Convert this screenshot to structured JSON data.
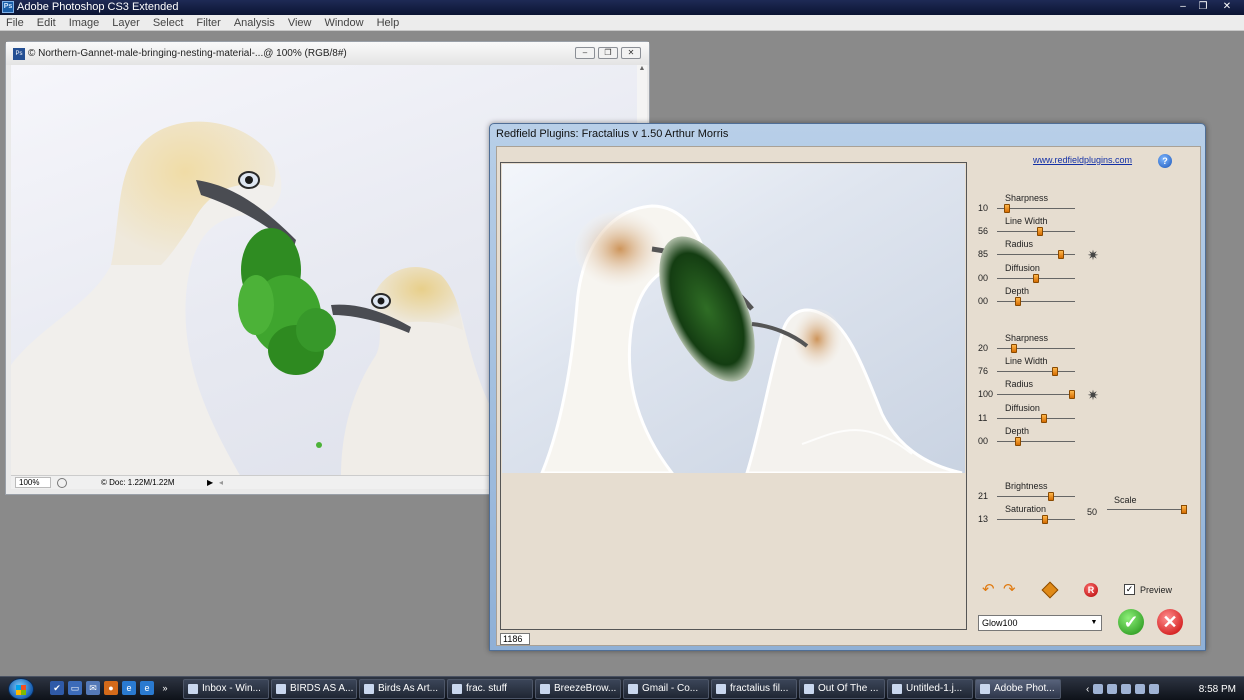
{
  "app": {
    "title": "Adobe Photoshop CS3 Extended",
    "logo": "Ps",
    "controls": {
      "minimize": "–",
      "restore": "❐",
      "close": "✕"
    }
  },
  "menu": [
    "File",
    "Edit",
    "Image",
    "Layer",
    "Select",
    "Filter",
    "Analysis",
    "View",
    "Window",
    "Help"
  ],
  "document": {
    "title": "© Northern-Gannet-male-bringing-nesting-material-...@ 100% (RGB/8#)",
    "icon": "Ps",
    "zoom": "100%",
    "doc_info": "© Doc: 1.22M/1.22M"
  },
  "plugin": {
    "title": "Redfield Plugins: Fractalius v 1.50   Arthur Morris",
    "link": "www.redfieldplugins.com",
    "help_label": "?",
    "counter": "1186",
    "group1": [
      {
        "label": "Sharpness",
        "value": "10",
        "level": 0.1
      },
      {
        "label": "Line Width",
        "value": "56",
        "level": 0.56
      },
      {
        "label": "Radius",
        "value": "85",
        "level": 0.85
      },
      {
        "label": "Diffusion",
        "value": "00",
        "level": 0.5
      },
      {
        "label": "Depth",
        "value": "00",
        "level": 0.25
      }
    ],
    "group2": [
      {
        "label": "Sharpness",
        "value": "20",
        "level": 0.2
      },
      {
        "label": "Line Width",
        "value": "76",
        "level": 0.76
      },
      {
        "label": "Radius",
        "value": "100",
        "level": 1.0
      },
      {
        "label": "Diffusion",
        "value": "11",
        "level": 0.61
      },
      {
        "label": "Depth",
        "value": "00",
        "level": 0.25
      }
    ],
    "group3": [
      {
        "label": "Brightness",
        "value": "21",
        "level": 0.71
      },
      {
        "label": "Saturation",
        "value": "13",
        "level": 0.63
      }
    ],
    "scale": {
      "label": "Scale",
      "value": "50",
      "level": 1.0
    },
    "preview_label": "Preview",
    "preview_checked": "✓",
    "preset": "Glow100",
    "ok_label": "✓",
    "cancel_label": "✕",
    "reset_label": "R"
  },
  "taskbar": {
    "tasks": [
      {
        "label": "Inbox - Win...",
        "active": false
      },
      {
        "label": "BIRDS AS A...",
        "active": false
      },
      {
        "label": "Birds As Art...",
        "active": false
      },
      {
        "label": "frac. stuff",
        "active": false
      },
      {
        "label": "BreezeBrow...",
        "active": false
      },
      {
        "label": "Gmail - Co...",
        "active": false
      },
      {
        "label": "fractalius fil...",
        "active": false
      },
      {
        "label": "Out Of The ...",
        "active": false
      },
      {
        "label": "Untitled-1.j...",
        "active": false
      },
      {
        "label": "Adobe Phot...",
        "active": true
      }
    ],
    "clock": "8:58 PM"
  }
}
